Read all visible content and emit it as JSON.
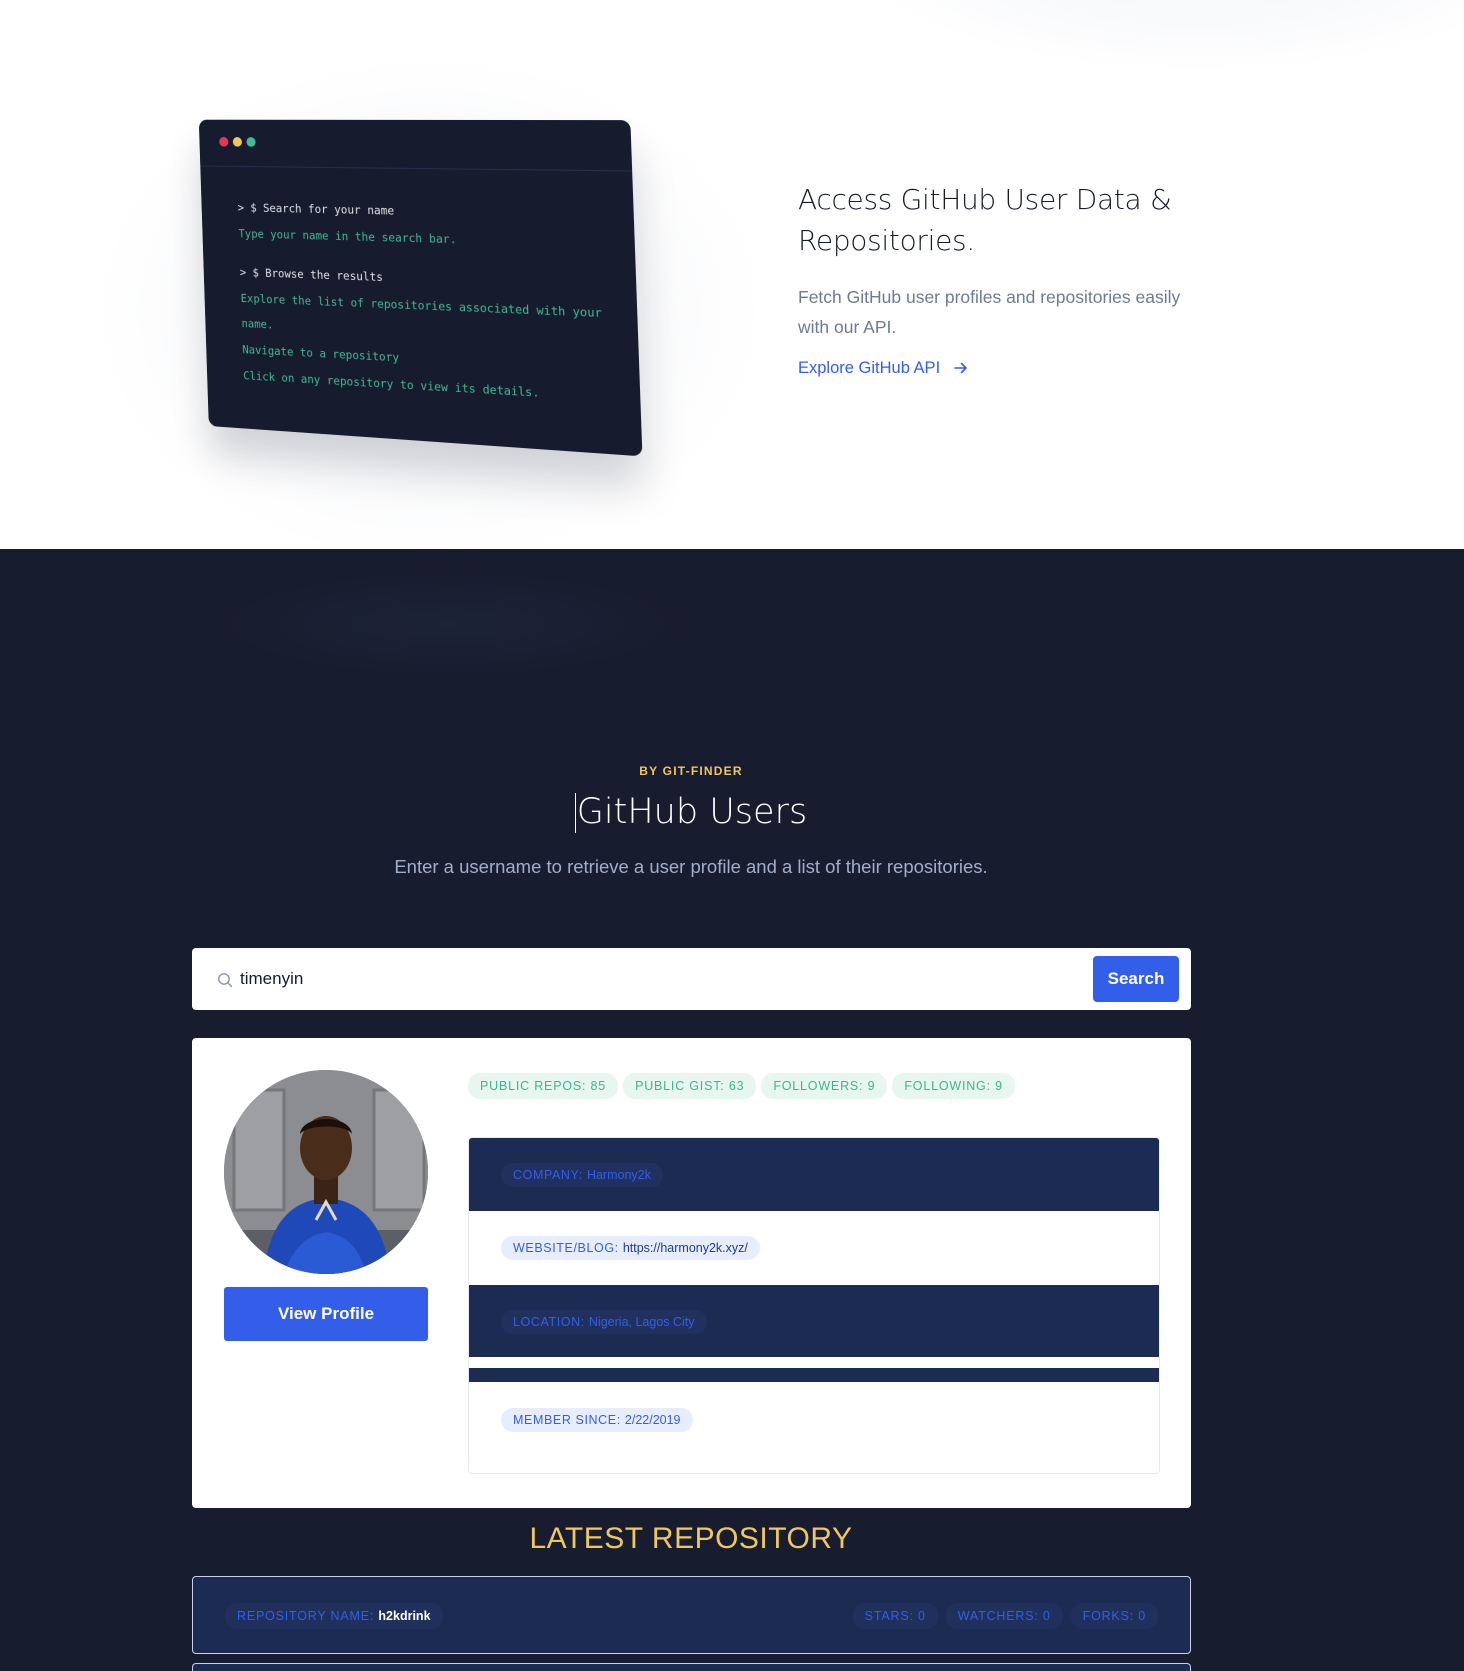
{
  "feature": {
    "terminal": {
      "dot_colors": [
        "#e53858",
        "#f0c75e",
        "#42ba96"
      ],
      "lines": [
        {
          "type": "cmd",
          "text": "> $ Search for your name"
        },
        {
          "type": "out",
          "text": "Type your name in the search bar."
        },
        {
          "type": "cmd",
          "text": "> $ Browse the results"
        },
        {
          "type": "out",
          "text": "Explore the list of repositories associated with your"
        },
        {
          "type": "out",
          "text": "name."
        },
        {
          "type": "out",
          "text": "Navigate to a  repository"
        },
        {
          "type": "out",
          "text": "Click on any repository to  view its details."
        }
      ]
    },
    "title": "Access GitHub User Data & Repositories.",
    "description": "Fetch GitHub user profiles and repositories easily with our API.",
    "link_label": "Explore GitHub API",
    "link_icon": "arrow-right-icon"
  },
  "users": {
    "eyebrow": "BY GIT-FINDER",
    "title": "GitHub Users",
    "subtitle": "Enter a username to retrieve a user profile and a list of their repositories.",
    "search": {
      "icon": "search-icon",
      "value": "timenyin",
      "button_label": "Search"
    },
    "profile": {
      "view_profile_label": "View Profile",
      "stats": [
        {
          "label": "PUBLIC REPOS:",
          "value": "85"
        },
        {
          "label": "PUBLIC GIST:",
          "value": "63"
        },
        {
          "label": "FOLLOWERS:",
          "value": "9"
        },
        {
          "label": "FOLLOWING:",
          "value": "9"
        }
      ],
      "company": {
        "label": "COMPANY:",
        "value": "Harmony2k"
      },
      "website": {
        "label": "WEBSITE/BLOG:",
        "value": "https://harmony2k.xyz/"
      },
      "location": {
        "label": "LOCATION:",
        "value": "Nigeria, Lagos City"
      },
      "member_since": {
        "label": "MEMBER SINCE:",
        "value": "2/22/2019"
      }
    },
    "latest_title": "LATEST REPOSITORY",
    "repository": {
      "name_label": "REPOSITORY NAME:",
      "name_value": "h2kdrink",
      "stars": "STARS: 0",
      "watchers": "WATCHERS: 0",
      "forks": "FORKS: 0"
    }
  },
  "colors": {
    "accent": "#335eea",
    "dark_bg": "#171c2e",
    "gold": "#f0c75e",
    "green": "#42ba96",
    "row_dark": "#1c2b52"
  }
}
